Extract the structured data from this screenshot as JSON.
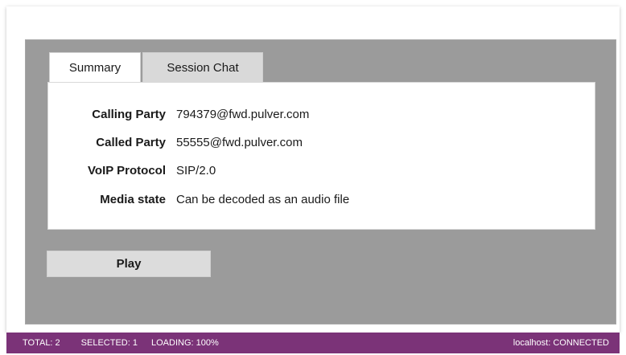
{
  "tabs": [
    {
      "label": "Summary",
      "active": true
    },
    {
      "label": "Session Chat",
      "active": false
    }
  ],
  "summary": {
    "rows": [
      {
        "label": "Calling Party",
        "value": "794379@fwd.pulver.com"
      },
      {
        "label": "Called Party",
        "value": "55555@fwd.pulver.com"
      },
      {
        "label": "VoIP Protocol",
        "value": "SIP/2.0"
      },
      {
        "label": "Media state",
        "value": "Can be decoded as an audio file"
      }
    ]
  },
  "play_label": "Play",
  "statusbar": {
    "total": "TOTAL: 2",
    "selected": "SELECTED: 1",
    "loading": "LOADING: 100%",
    "connection": "localhost: CONNECTED",
    "color": "#7b3378"
  }
}
